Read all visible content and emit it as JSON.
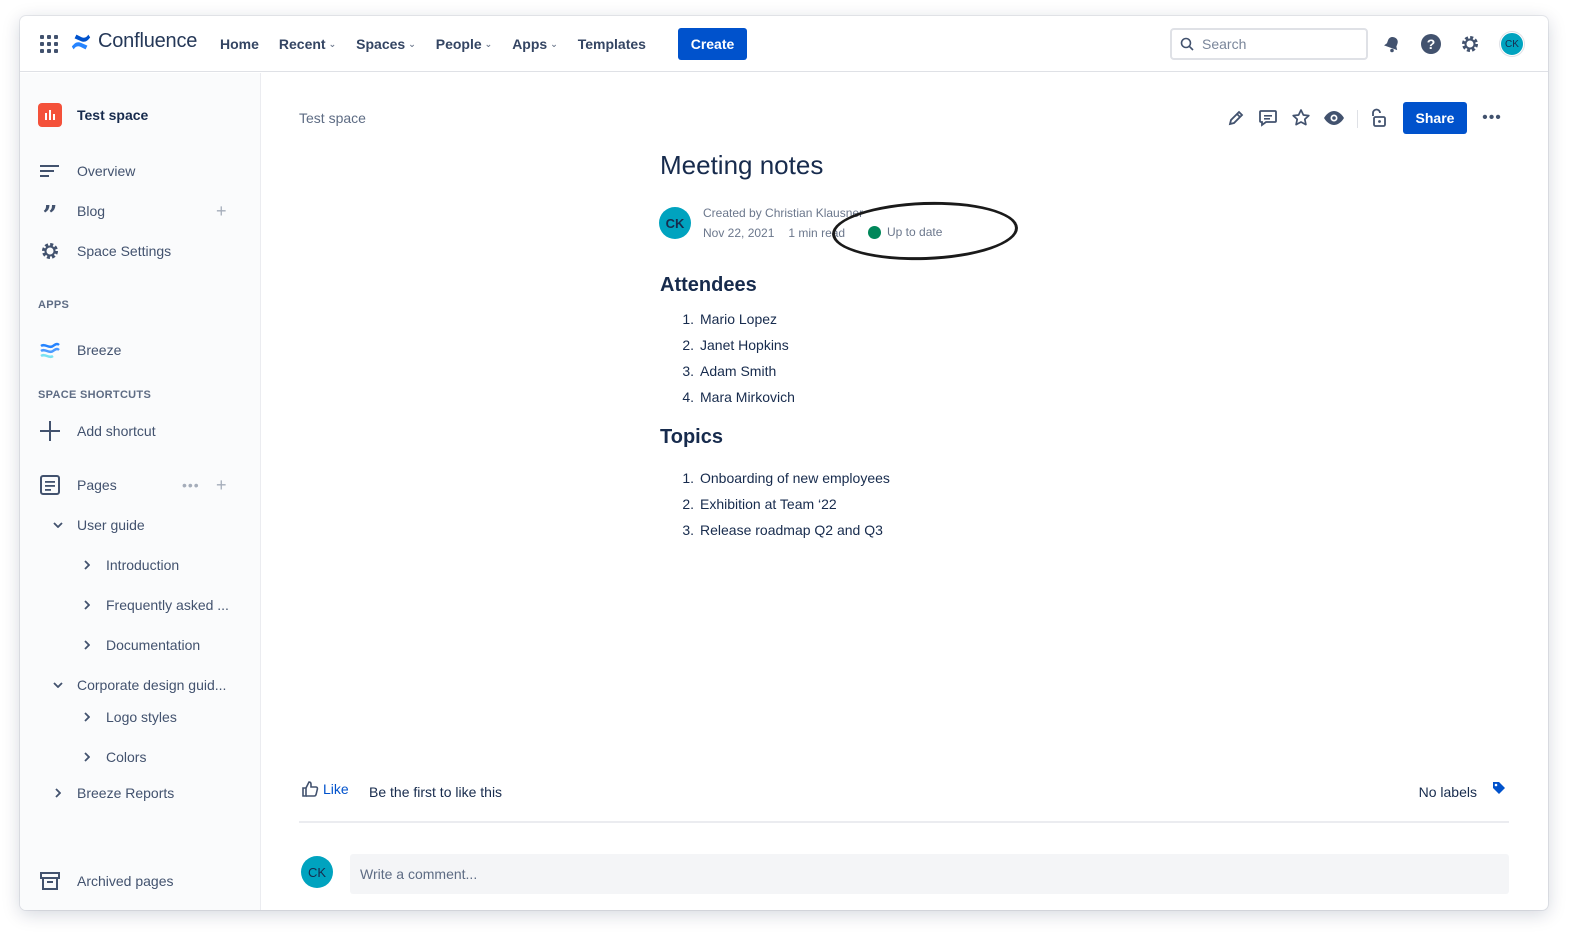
{
  "app": {
    "name": "Confluence",
    "nav": [
      {
        "label": "Home",
        "dropdown": false
      },
      {
        "label": "Recent",
        "dropdown": true
      },
      {
        "label": "Spaces",
        "dropdown": true
      },
      {
        "label": "People",
        "dropdown": true
      },
      {
        "label": "Apps",
        "dropdown": true
      },
      {
        "label": "Templates",
        "dropdown": false
      }
    ],
    "create_label": "Create",
    "search_placeholder": "Search",
    "user_initials": "CK",
    "accent": "#0052CC"
  },
  "sidebar": {
    "space_name": "Test space",
    "items": [
      {
        "label": "Overview",
        "icon": "overview-icon"
      },
      {
        "label": "Blog",
        "icon": "quote-icon"
      },
      {
        "label": "Space Settings",
        "icon": "gear-icon"
      }
    ],
    "apps_heading": "APPS",
    "apps": [
      {
        "label": "Breeze",
        "icon": "breeze-icon"
      }
    ],
    "shortcuts_heading": "SPACE SHORTCUTS",
    "add_shortcut": "Add shortcut",
    "pages_label": "Pages",
    "tree": [
      {
        "label": "User guide",
        "level": 1,
        "expanded": true
      },
      {
        "label": "Introduction",
        "level": 2,
        "expanded": false
      },
      {
        "label": "Frequently asked ...",
        "level": 2,
        "expanded": false
      },
      {
        "label": "Documentation",
        "level": 2,
        "expanded": false
      },
      {
        "label": "Corporate design guid...",
        "level": 1,
        "expanded": true
      },
      {
        "label": "Logo styles",
        "level": 2,
        "expanded": false
      },
      {
        "label": "Colors",
        "level": 2,
        "expanded": false
      },
      {
        "label": "Breeze Reports",
        "level": 1,
        "expanded": false
      }
    ],
    "archived": "Archived pages"
  },
  "page": {
    "breadcrumb": "Test space",
    "share_label": "Share",
    "title": "Meeting notes",
    "author_initials": "CK",
    "created_by": "Created by Christian Klausner",
    "date": "Nov 22, 2021",
    "read_time": "1 min read",
    "status": "Up to date",
    "status_color": "#00875A",
    "attendees_heading": "Attendees",
    "attendees": [
      "Mario Lopez",
      "Janet Hopkins",
      "Adam Smith",
      "Mara Mirkovich"
    ],
    "topics_heading": "Topics",
    "topics": [
      "Onboarding of new employees",
      "Exhibition at Team ‘22",
      "Release roadmap Q2 and Q3"
    ],
    "like_label": "Like",
    "like_text": "Be the first to like this",
    "labels_text": "No labels",
    "comment_placeholder": "Write a comment..."
  }
}
